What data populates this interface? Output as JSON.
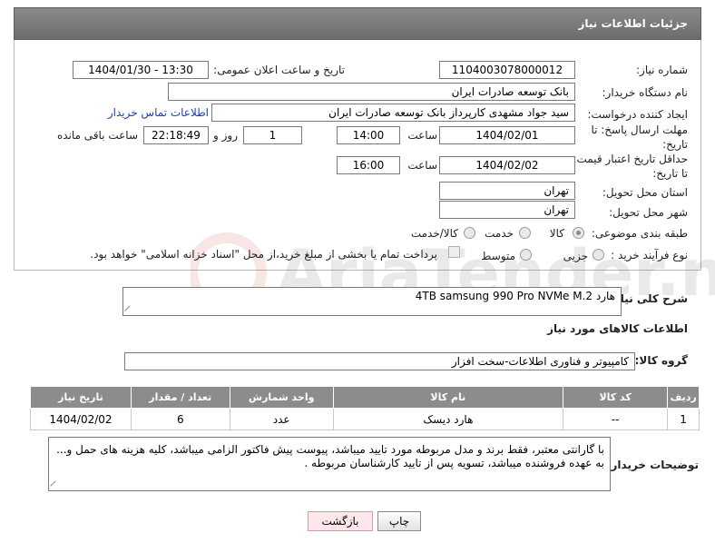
{
  "header": {
    "title": "جزئیات اطلاعات نیاز"
  },
  "form": {
    "need_number_label": "شماره نیاز:",
    "need_number": "1104003078000012",
    "announce_label": "تاریخ و ساعت اعلان عمومی:",
    "announce_value": "1404/01/30 - 13:30",
    "buyer_org_label": "نام دستگاه خریدار:",
    "buyer_org": "بانک توسعه صادرات ایران",
    "creator_label": "ایجاد کننده درخواست:",
    "creator": "سید جواد مشهدی کارپرداز بانک توسعه صادرات ایران",
    "contact_link": "اطلاعات تماس خریدار",
    "deadline_label_1": "مهلت ارسال پاسخ: تا",
    "deadline_label_2": "تاریخ:",
    "deadline_date": "1404/02/01",
    "time_label": "ساعت",
    "deadline_time": "14:00",
    "days_value": "1",
    "days_label": "روز و",
    "remaining_time": "22:18:49",
    "remaining_label": "ساعت باقی مانده",
    "min_validity_label_1": "حداقل تاریخ اعتبار قیمت:",
    "min_validity_label_2": "تا تاریخ:",
    "validity_date": "1404/02/02",
    "validity_time": "16:00",
    "province_label": "استان محل تحویل:",
    "province": "تهران",
    "city_label": "شهر محل تحویل:",
    "city": "تهران",
    "category_label": "طبقه بندی موضوعی:",
    "category_options": [
      "کالا",
      "خدمت",
      "کالا/خدمت"
    ],
    "process_label": "نوع فرآیند خرید :",
    "process_options": [
      "جزیی",
      "متوسط"
    ],
    "payment_note": "پرداخت تمام یا بخشی از مبلغ خرید،از محل \"اسناد خزانه اسلامی\" خواهد بود."
  },
  "summary": {
    "label": "شرح کلی نیاز:",
    "value": "هارد    4TB    samsung 990 Pro NVMe M.2"
  },
  "goods": {
    "section_title": "اطلاعات کالاهای مورد نیاز",
    "group_label": "گروه کالا:",
    "group_value": "کامپیوتر و فناوری اطلاعات-سخت افزار",
    "columns": [
      "ردیف",
      "کد کالا",
      "نام کالا",
      "واحد شمارش",
      "تعداد / مقدار",
      "تاریخ نیاز"
    ],
    "rows": [
      [
        "1",
        "--",
        "هارد دیسک",
        "عدد",
        "6",
        "1404/02/02"
      ]
    ]
  },
  "buyer_notes": {
    "label": "توضیحات خریدار:",
    "line1": "با گارانتی معتبر، فقط برند و مدل مربوطه مورد تایید میباشد، پیوست پیش فاکتور الزامی میباشد، کلیه هزینه های حمل و...",
    "line2": "به عهده فروشنده میباشد، تسویه پس از تایید کارشناسان مربوطه ."
  },
  "buttons": {
    "print": "چاپ",
    "back": "بازگشت"
  },
  "colors": {
    "header_bg": "#7a7a7a",
    "table_header_bg": "#8c8c8c",
    "link": "#1a3fb5"
  }
}
